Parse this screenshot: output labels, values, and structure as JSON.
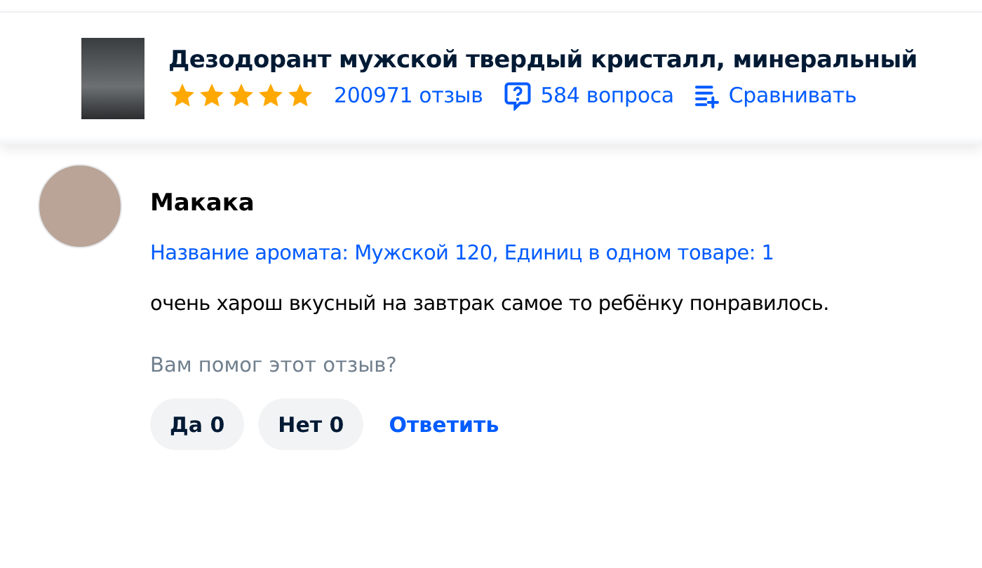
{
  "product": {
    "title": "Дезодорант мужской твердый кристалл, минеральный",
    "stars": 5,
    "reviews_link": "200971 отзыв",
    "questions_link": "584 вопроса",
    "compare_link": "Сравнивать"
  },
  "review": {
    "author": "Макака",
    "options": "Название аромата: Мужской 120, Единиц в одном товаре: 1",
    "text": "очень харош вкусный на завтрак самое то ребёнку понравилось.",
    "helpful_question": "Вам помог этот отзыв?",
    "buttons": [
      {
        "kind": "vote",
        "label": "Да 0"
      },
      {
        "kind": "vote",
        "label": "Нет 0"
      },
      {
        "kind": "link",
        "label": "Ответить"
      }
    ]
  }
}
